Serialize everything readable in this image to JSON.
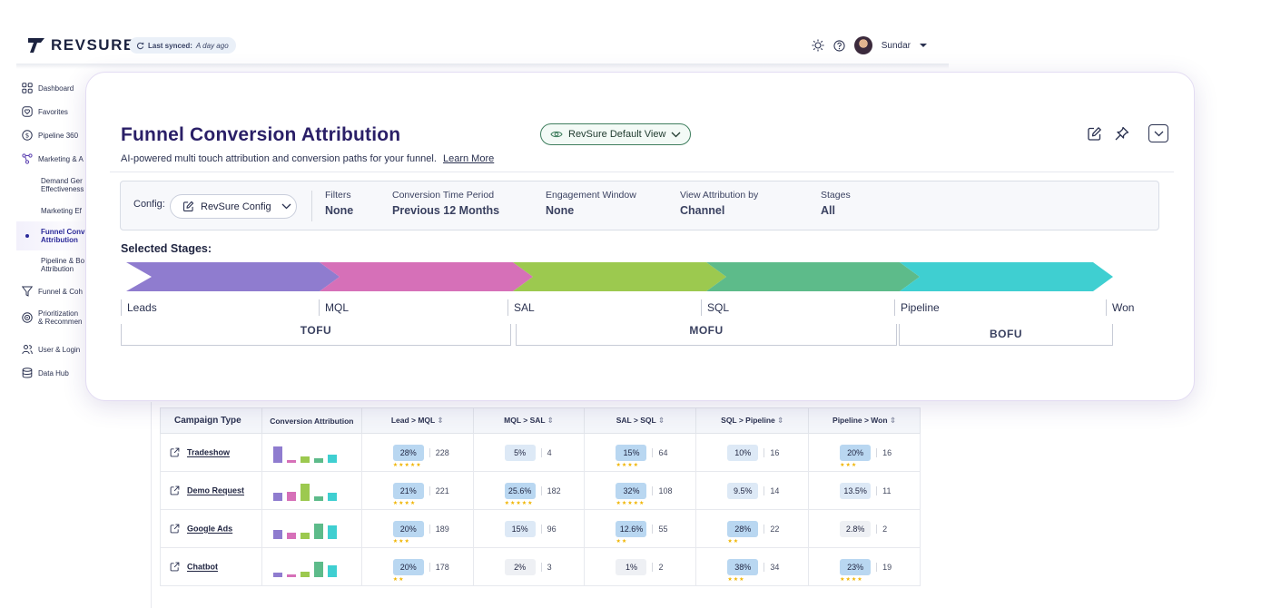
{
  "app": {
    "logo_text": "REVSURE",
    "sync": {
      "label": "Last synced:",
      "value": "A day ago"
    },
    "user": {
      "name": "Sundar"
    }
  },
  "sidebar": {
    "items": [
      {
        "label": "Dashboard",
        "icon": "grid-icon"
      },
      {
        "label": "Favorites",
        "icon": "heart-icon"
      },
      {
        "label": "Pipeline 360",
        "icon": "dollar-icon"
      },
      {
        "label": "Marketing & A",
        "icon": "network-icon"
      }
    ],
    "subitems": [
      {
        "label": "Demand Gen Effectiveness",
        "line1": "Demand Ger",
        "line2": "Effectiveness"
      },
      {
        "label": "Marketing Ef",
        "line1": "Marketing Ef",
        "line2": ""
      },
      {
        "label": "Funnel Conversion Attribution",
        "line1": "Funnel Conv",
        "line2": "Attribution"
      },
      {
        "label": "Pipeline & Bookings Attribution",
        "line1": "Pipeline & Bo",
        "line2": "Attribution"
      }
    ],
    "items_bottom": [
      {
        "label": "Funnel & Coh",
        "icon": "filter-icon"
      },
      {
        "label": "Prioritization & Recommen",
        "line1": "Prioritization",
        "line2": "& Recommen",
        "icon": "target-icon"
      },
      {
        "label": "User & Login",
        "icon": "users-icon"
      },
      {
        "label": "Data Hub",
        "icon": "database-icon"
      }
    ]
  },
  "card": {
    "title": "Funnel Conversion Attribution",
    "subtitle": "AI-powered multi touch attribution and conversion paths for your funnel.",
    "learn_more": "Learn More",
    "view_selector": "RevSure Default View",
    "config": {
      "label": "Config:",
      "value": "RevSure Config",
      "fields": [
        {
          "key": "Filters",
          "value": "None"
        },
        {
          "key": "Conversion Time Period",
          "value": "Previous 12 Months"
        },
        {
          "key": "Engagement Window",
          "value": "None"
        },
        {
          "key": "View Attribution by",
          "value": "Channel"
        },
        {
          "key": "Stages",
          "value": "All"
        }
      ]
    },
    "selected_stages_label": "Selected Stages:",
    "stages": [
      "Leads",
      "MQL",
      "SAL",
      "SQL",
      "Pipeline",
      "Won"
    ],
    "stage_colors": [
      "#8f7ccf",
      "#d670b8",
      "#9cc94f",
      "#5dbb8a",
      "#3fcfd1"
    ],
    "groups": [
      "TOFU",
      "MOFU",
      "BOFU"
    ]
  },
  "table": {
    "columns": [
      "Campaign Type",
      "Conversion Attribution",
      "Lead > MQL",
      "MQL > SAL",
      "SAL > SQL",
      "SQL > Pipeline",
      "Pipeline > Won"
    ],
    "rows": [
      {
        "name": "Tradeshow",
        "bars": [
          0.9,
          0.15,
          0.35,
          0.25,
          0.45
        ],
        "metrics": [
          {
            "pct": "28%",
            "count": "228",
            "stars": "★★★★★",
            "level": 2
          },
          {
            "pct": "5%",
            "count": "4",
            "stars": "",
            "level": 1
          },
          {
            "pct": "15%",
            "count": "64",
            "stars": "★★★★",
            "level": 2
          },
          {
            "pct": "10%",
            "count": "16",
            "stars": "",
            "level": 1
          },
          {
            "pct": "20%",
            "count": "16",
            "stars": "★★★",
            "level": 2
          }
        ]
      },
      {
        "name": "Demo Request",
        "bars": [
          0.45,
          0.5,
          0.95,
          0.25,
          0.45
        ],
        "metrics": [
          {
            "pct": "21%",
            "count": "221",
            "stars": "★★★★",
            "level": 2
          },
          {
            "pct": "25.6%",
            "count": "182",
            "stars": "★★★★★",
            "level": 2
          },
          {
            "pct": "32%",
            "count": "108",
            "stars": "★★★★★",
            "level": 2
          },
          {
            "pct": "9.5%",
            "count": "14",
            "stars": "",
            "level": 1
          },
          {
            "pct": "13.5%",
            "count": "11",
            "stars": "",
            "level": 1
          }
        ]
      },
      {
        "name": "Google Ads",
        "bars": [
          0.5,
          0.35,
          0.35,
          0.85,
          0.75
        ],
        "metrics": [
          {
            "pct": "20%",
            "count": "189",
            "stars": "★★★",
            "level": 2
          },
          {
            "pct": "15%",
            "count": "96",
            "stars": "",
            "level": 1
          },
          {
            "pct": "12.6%",
            "count": "55",
            "stars": "★★",
            "level": 2
          },
          {
            "pct": "28%",
            "count": "22",
            "stars": "★★",
            "level": 2
          },
          {
            "pct": "2.8%",
            "count": "2",
            "stars": "",
            "level": 0
          }
        ]
      },
      {
        "name": "Chatbot",
        "bars": [
          0.25,
          0.15,
          0.3,
          0.85,
          0.65
        ],
        "metrics": [
          {
            "pct": "20%",
            "count": "178",
            "stars": "★★",
            "level": 2
          },
          {
            "pct": "2%",
            "count": "3",
            "stars": "",
            "level": 0
          },
          {
            "pct": "1%",
            "count": "2",
            "stars": "",
            "level": 0
          },
          {
            "pct": "38%",
            "count": "34",
            "stars": "★★★",
            "level": 2
          },
          {
            "pct": "23%",
            "count": "19",
            "stars": "★★★★",
            "level": 2
          }
        ]
      }
    ],
    "level_colors": [
      "#eef0f4",
      "#dde9f6",
      "#b9d7f1"
    ]
  }
}
